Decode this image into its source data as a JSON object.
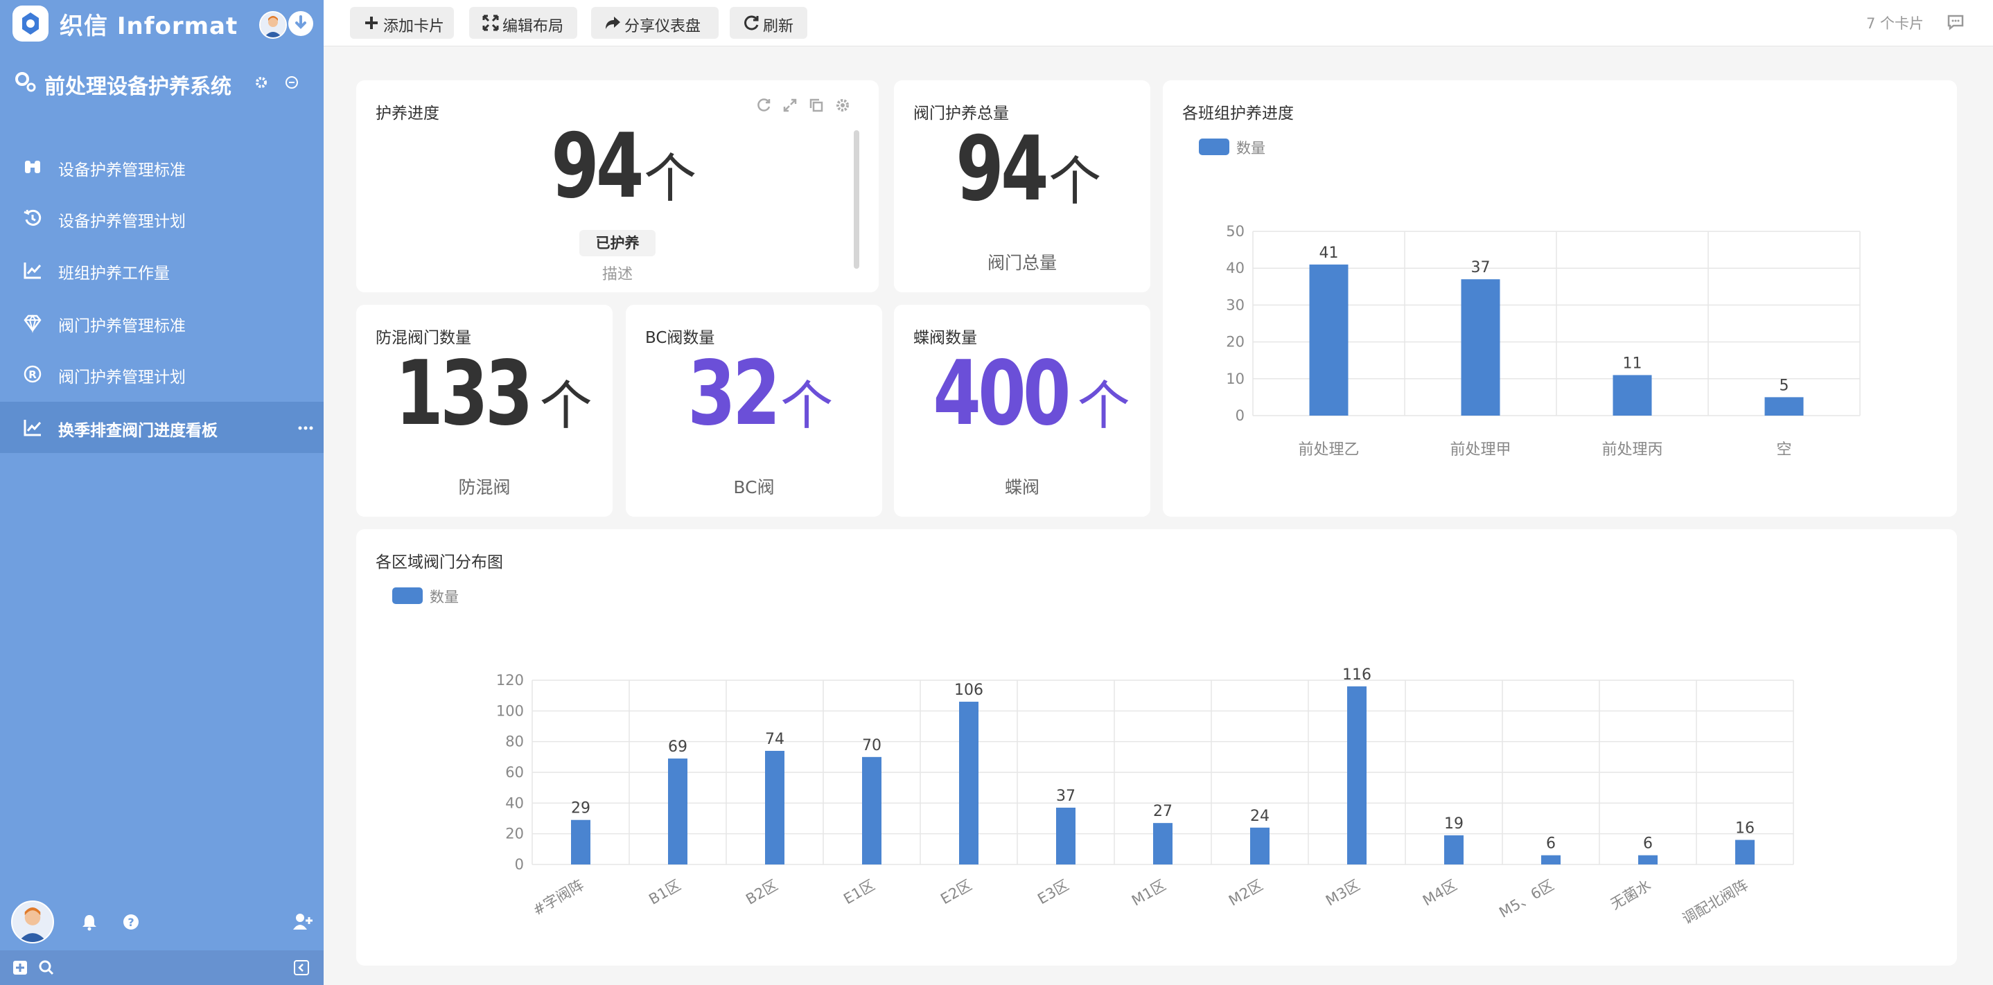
{
  "app": {
    "logo_text": "织信 Informat"
  },
  "sidebar": {
    "system_title": "前处理设备护养系统",
    "items": [
      {
        "label": "设备护养管理标准",
        "icon": "binoculars-icon"
      },
      {
        "label": "设备护养管理计划",
        "icon": "history-icon"
      },
      {
        "label": "班组护养工作量",
        "icon": "line-chart-icon"
      },
      {
        "label": "阀门护养管理标准",
        "icon": "diamond-icon"
      },
      {
        "label": "阀门护养管理计划",
        "icon": "registered-icon"
      },
      {
        "label": "换季排查阀门进度看板",
        "icon": "line-chart-icon",
        "active": true
      }
    ]
  },
  "toolbar": {
    "add_card": "添加卡片",
    "edit_layout": "编辑布局",
    "share_dashboard": "分享仪表盘",
    "refresh": "刷新",
    "card_count": "7 个卡片"
  },
  "cards": {
    "maintenance_progress": {
      "title": "护养进度",
      "value": "94",
      "unit": "个",
      "tag": "已护养",
      "desc": "描述"
    },
    "valve_total": {
      "title": "阀门护养总量",
      "value": "94",
      "unit": "个",
      "subtitle": "阀门总量"
    },
    "mixproof": {
      "title": "防混阀门数量",
      "value": "133",
      "unit": "个",
      "subtitle": "防混阀"
    },
    "bc_valve": {
      "title": "BC阀数量",
      "value": "32",
      "unit": "个",
      "subtitle": "BC阀"
    },
    "butterfly": {
      "title": "蝶阀数量",
      "value": "400",
      "unit": "个",
      "subtitle": "蝶阀"
    }
  },
  "colors": {
    "sidebar_bg": "#709fdf",
    "bar": "#4a84d0",
    "accent_purple": "#6b4fd8"
  },
  "chart_data": [
    {
      "type": "bar",
      "title": "各班组护养进度",
      "legend": [
        "数量"
      ],
      "categories": [
        "前处理乙",
        "前处理甲",
        "前处理丙",
        "空"
      ],
      "series": [
        {
          "name": "数量",
          "values": [
            41,
            37,
            11,
            5
          ]
        }
      ],
      "ylim": [
        0,
        50
      ],
      "yticks": [
        0,
        10,
        20,
        30,
        40,
        50
      ],
      "grid": true,
      "data_labels": true
    },
    {
      "type": "bar",
      "title": "各区域阀门分布图",
      "legend": [
        "数量"
      ],
      "categories": [
        "#字阀阵",
        "B1区",
        "B2区",
        "E1区",
        "E2区",
        "E3区",
        "M1区",
        "M2区",
        "M3区",
        "M4区",
        "M5、6区",
        "无菌水",
        "调配北阀阵"
      ],
      "series": [
        {
          "name": "数量",
          "values": [
            29,
            69,
            74,
            70,
            106,
            37,
            27,
            24,
            116,
            19,
            6,
            6,
            16
          ]
        }
      ],
      "ylim": [
        0,
        120
      ],
      "yticks": [
        0,
        20,
        40,
        60,
        80,
        100,
        120
      ],
      "grid": true,
      "data_labels": true
    }
  ]
}
